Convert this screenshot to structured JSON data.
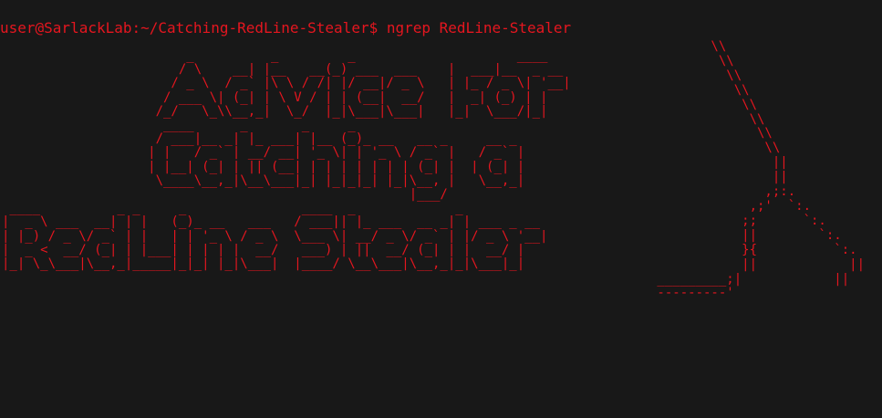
{
  "terminal": {
    "prompt": "user@SarlackLab:~/Catching-RedLine-Stealer$",
    "command": "ngrep RedLine-Stealer",
    "text_color": "#e5161f",
    "background_color": "#181818"
  },
  "banner": {
    "art": "                        _          _         _                     ____\n                       / \\    __| |__   __(_) ___  ___    |  ___|__  _ __\n                      / _ \\  / _` |\\ \\ / /| |/ __|/ _ \\   | |_ / _ \\| '__|\n                     / ___ \\| (_| | \\ V / | | (__|  __/   |  _| (_) | |\n                    /_/   \\_\\\\__,_|  \\_/  |_|\\___|\\___|   |_|  \\___/|_|\n                     ____      _       _     _\n                    / ___|__ _| |_ ___| |__ (_)_ __   __ _     __ _\n                   | |   / _` | __/ __| '_ \\| | '_ \\ / _` |   / _` |\n                   | |__| (_| | || (__| | | | | | | | (_| |  | (_| |\n                    \\____\\__,_|\\__\\___|_| |_|_|_| |_|\\__, |   \\__,_|\n                                                     |___/\n ____          _ _     _               ____  _             _\n|  _ \\ ___  __| | |   (_)_ __   ___   / ___|| |_ ___  __ _| | ___ _ __\n| |_) / _ \\/ _` | |   | | '_ \\ / _ \\  \\___ \\| __/ _ \\/ _` | |/ _ \\ '__|\n|  _ <  __/ (_| | |___| | | | |  __/   ___) | ||  __/ (_| | |  __/ |\n|_| \\_\\___|\\__,_|_____|_|_| |_|\\___|  |____/ \\__\\___|\\__,_|_|\\___|_|"
  },
  "network_art": {
    "art": "        \\\\\n         \\\\\n          \\\\\n           \\\\\n            \\\\\n             \\\\\n              \\\\\n               \\\\\n                ||\n                ||\n               ,;:.\n             ,;'  `:.\n            ;;      `:.\n            ||        `:.\n            }{          `:.\n            ||            ||\n _________;|            ||\n ---------'"
  }
}
